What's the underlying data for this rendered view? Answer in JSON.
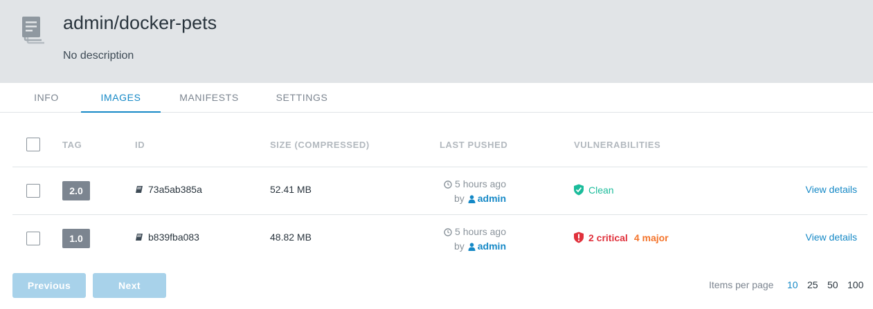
{
  "repo": {
    "title": "admin/docker-pets",
    "description": "No description",
    "icon": "repository-stack-icon"
  },
  "tabs": [
    {
      "label": "INFO",
      "active": false
    },
    {
      "label": "IMAGES",
      "active": true
    },
    {
      "label": "MANIFESTS",
      "active": false
    },
    {
      "label": "SETTINGS",
      "active": false
    }
  ],
  "table": {
    "columns": [
      "TAG",
      "ID",
      "SIZE (COMPRESSED)",
      "LAST PUSHED",
      "VULNERABILITIES"
    ],
    "rows": [
      {
        "tag": "2.0",
        "id": "73a5ab385a",
        "size": "52.41 MB",
        "pushed_time": "5 hours ago",
        "pushed_by_prefix": "by",
        "pushed_by": "admin",
        "vulnerability": {
          "status": "clean",
          "label": "Clean"
        },
        "details": "View details"
      },
      {
        "tag": "1.0",
        "id": "b839fba083",
        "size": "48.82 MB",
        "pushed_time": "5 hours ago",
        "pushed_by_prefix": "by",
        "pushed_by": "admin",
        "vulnerability": {
          "status": "vulnerable",
          "critical": "2 critical",
          "major": "4 major"
        },
        "details": "View details"
      }
    ]
  },
  "pagination": {
    "previous": "Previous",
    "next": "Next",
    "items_per_page_label": "Items per page",
    "options": [
      "10",
      "25",
      "50",
      "100"
    ],
    "selected": "10"
  },
  "colors": {
    "accent": "#1488c6",
    "header_bg": "#e1e4e7",
    "clean": "#1bbc9b",
    "critical": "#e0313c",
    "major": "#f4742b",
    "disabled_button": "#a8d2ea"
  }
}
